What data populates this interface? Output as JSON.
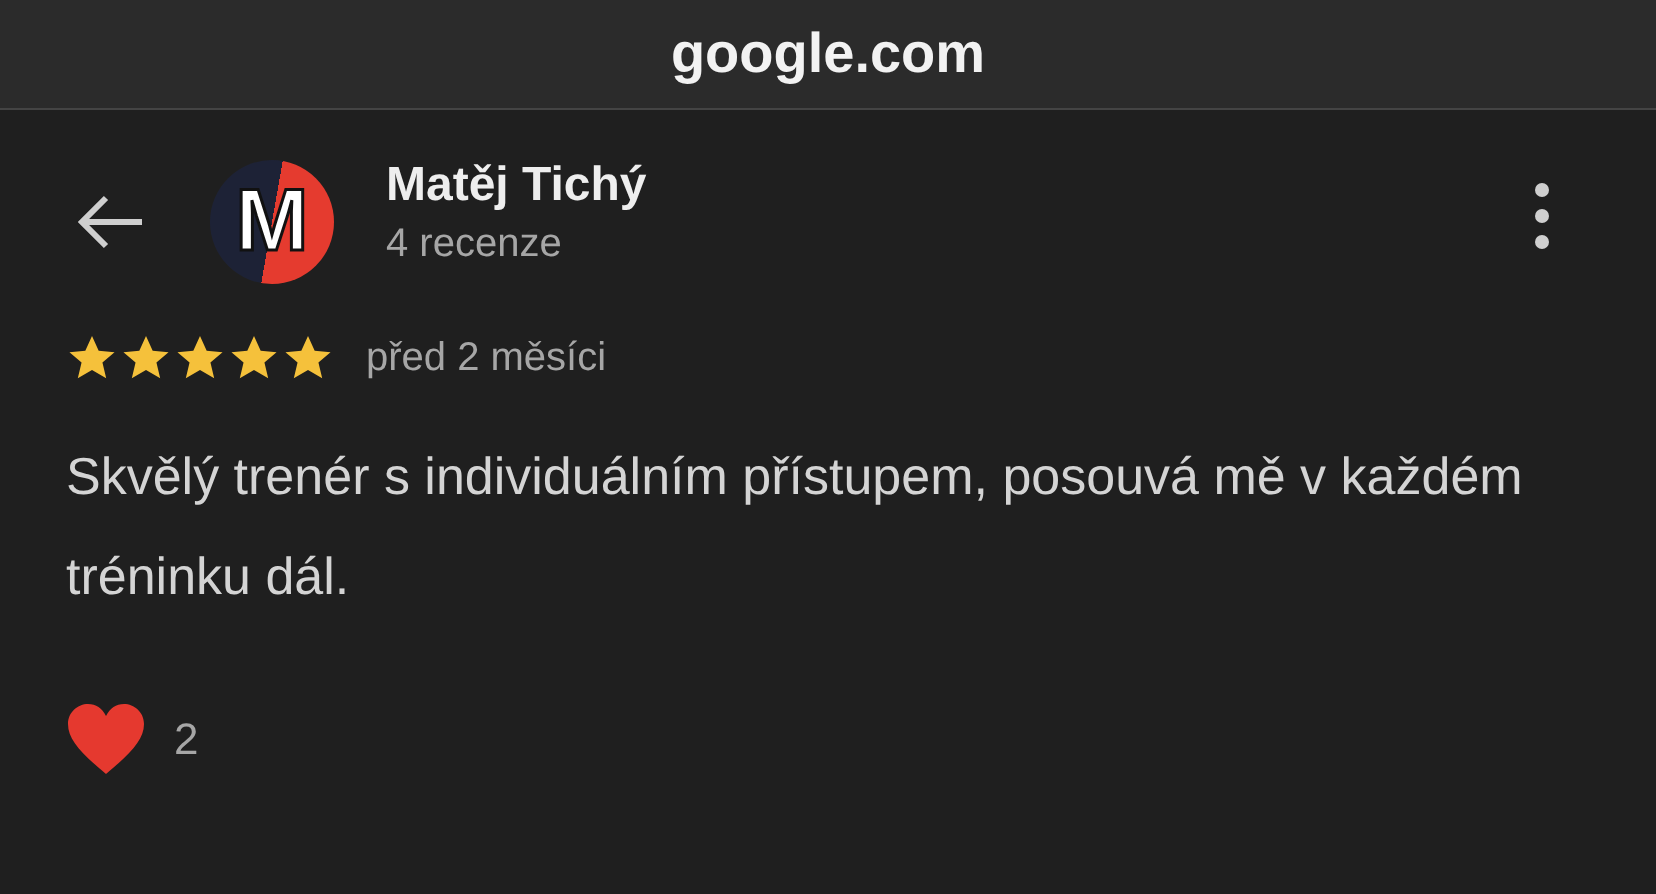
{
  "browser": {
    "address": "google.com"
  },
  "reviewer": {
    "avatar_letter": "M",
    "name": "Matěj Tichý",
    "reviews": "4 recenze"
  },
  "review": {
    "stars": 5,
    "time": "před 2 měsíci",
    "text": "Skvělý trenér s individuálním přístupem, posouvá mě v každém tréninku dál."
  },
  "reactions": {
    "count": "2"
  }
}
